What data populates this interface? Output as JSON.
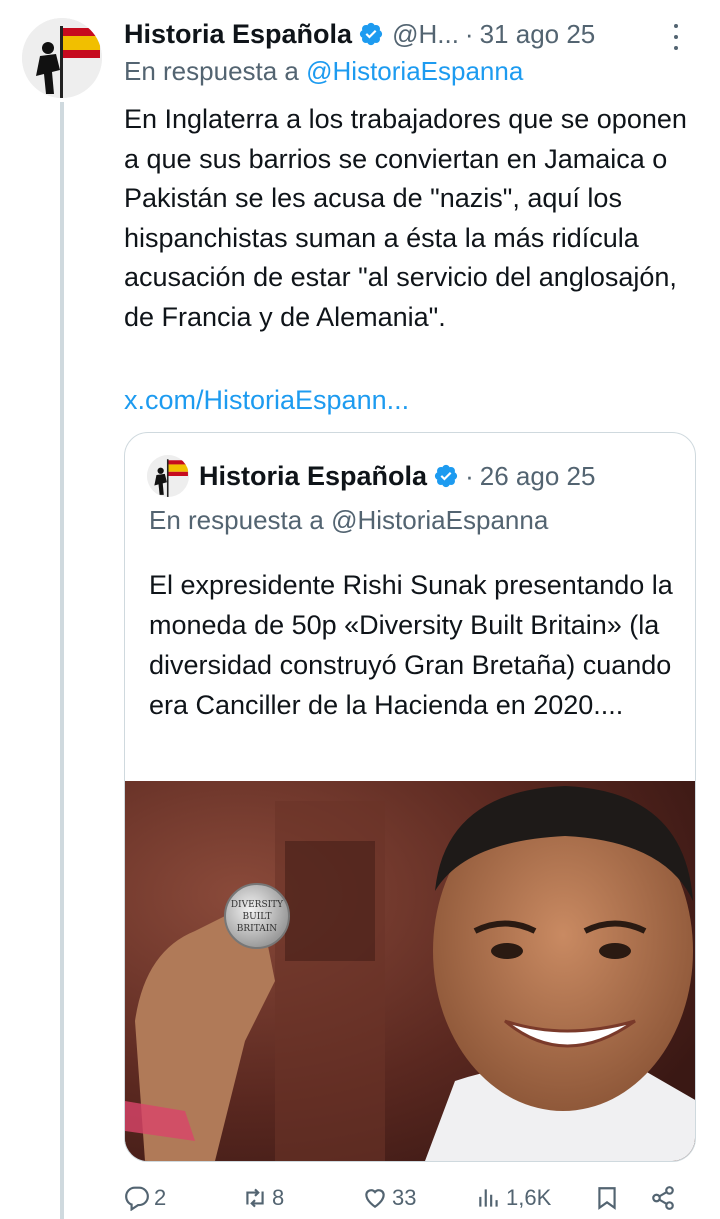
{
  "tweet": {
    "author_name": "Historia Española",
    "handle": "@H...",
    "separator": "·",
    "date": "31 ago 25",
    "reply_prefix": "En respuesta a",
    "reply_mention": "@HistoriaEspanna",
    "text": "En Inglaterra a los trabajadores que se oponen a que sus barrios se conviertan en Jamaica o Pakistán se les acusa de \"nazis\", aquí los hispanchistas suman a ésta la más ridícula acusación de estar \"al servicio del anglosajón, de Francia y de Alemania\".",
    "link": "x.com/HistoriaEspann..."
  },
  "quote": {
    "author_name": "Historia Española",
    "separator": "·",
    "date": "26 ago 25",
    "reply_text": "En respuesta a @HistoriaEspanna",
    "text": "El expresidente Rishi Sunak presentando la moneda de 50p «Diversity Built Britain» (la diversidad construyó Gran Bretaña) cuando era Canciller de la Hacienda en 2020....",
    "coin_text": [
      "DIVERSITY",
      "BUILT",
      "BRITAIN"
    ]
  },
  "actions": {
    "replies": "2",
    "reposts": "8",
    "likes": "33",
    "views": "1,6K",
    "icons": [
      "reply-icon",
      "repost-icon",
      "like-icon",
      "views-icon",
      "bookmark-icon",
      "share-icon"
    ]
  },
  "colors": {
    "text": "#0f1419",
    "secondary": "#536471",
    "link": "#1d9bf0",
    "border": "#cfd9de",
    "verified": "#1d9bf0"
  }
}
